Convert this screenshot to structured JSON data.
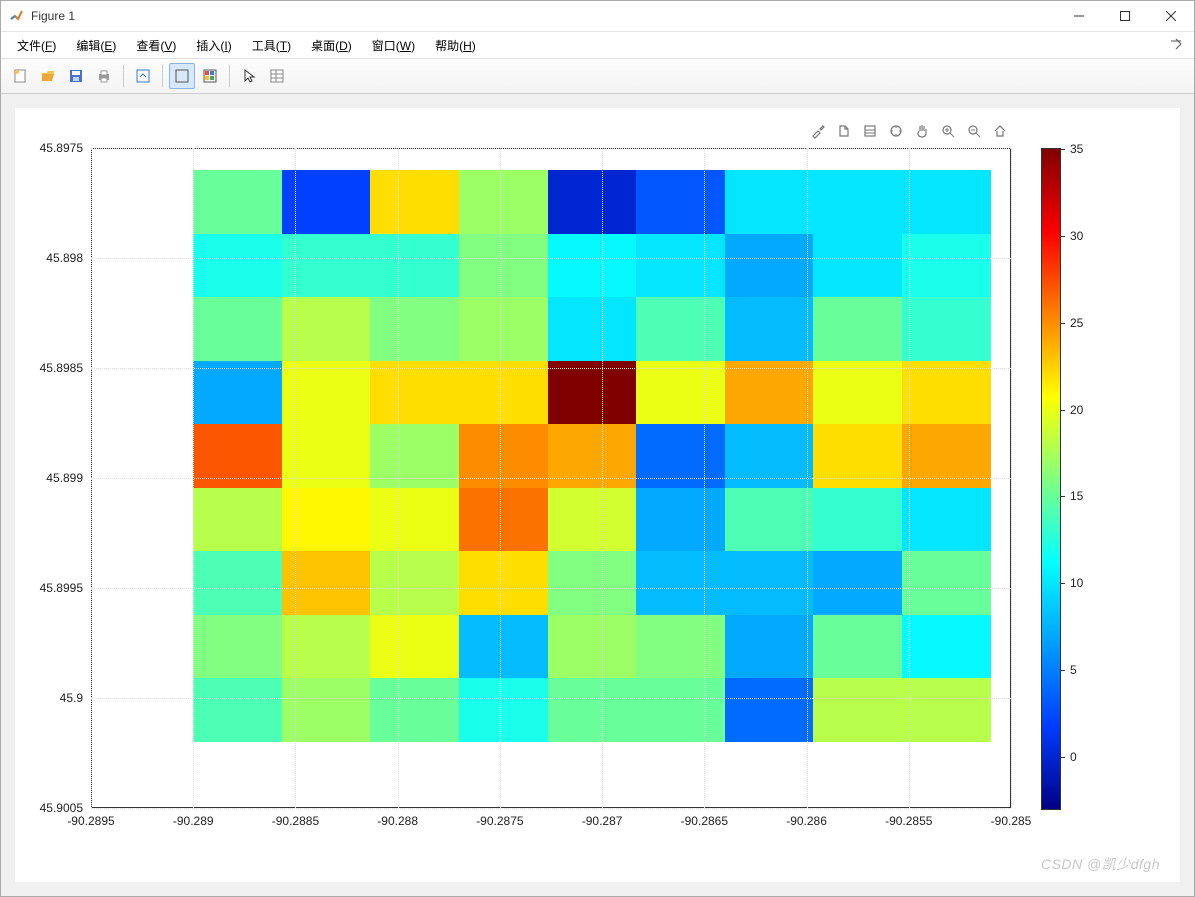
{
  "window": {
    "title": "Figure 1"
  },
  "menus": [
    {
      "label": "文件",
      "accel": "F"
    },
    {
      "label": "编辑",
      "accel": "E"
    },
    {
      "label": "查看",
      "accel": "V"
    },
    {
      "label": "插入",
      "accel": "I"
    },
    {
      "label": "工具",
      "accel": "T"
    },
    {
      "label": "桌面",
      "accel": "D"
    },
    {
      "label": "窗口",
      "accel": "W"
    },
    {
      "label": "帮助",
      "accel": "H"
    }
  ],
  "toolbar": {
    "buttons": [
      "new",
      "open",
      "save",
      "print",
      "sep",
      "link",
      "sep",
      "cursor-select",
      "colorbar",
      "sep",
      "pointer",
      "properties"
    ]
  },
  "figtoolbar": [
    "brush",
    "export",
    "insert-legend",
    "data-tips",
    "pan",
    "zoom-in",
    "zoom-out",
    "home"
  ],
  "watermark": "CSDN @凯少dfgh",
  "chart_data": {
    "type": "heatmap",
    "xlim": [
      -90.2895,
      -90.285
    ],
    "ylim_top_to_bottom": [
      45.8975,
      45.9005
    ],
    "xticks": [
      -90.2895,
      -90.289,
      -90.2885,
      -90.288,
      -90.2875,
      -90.287,
      -90.2865,
      -90.286,
      -90.2855,
      -90.285
    ],
    "yticks": [
      45.8975,
      45.898,
      45.8985,
      45.899,
      45.8995,
      45.9,
      45.9005
    ],
    "colorbar": {
      "min": -3,
      "max": 35,
      "ticks": [
        0,
        5,
        10,
        15,
        20,
        25,
        30,
        35
      ]
    },
    "data_extent": {
      "x0": -90.289,
      "x1": -90.2851,
      "y0": 45.8976,
      "y1": 45.9002,
      "cols": 9,
      "rows": 9
    },
    "values_top_to_bottom": [
      [
        15,
        2,
        22,
        17,
        0,
        3,
        10,
        10,
        10
      ],
      [
        12,
        13,
        13,
        16,
        11,
        10,
        7,
        10,
        12
      ],
      [
        15,
        18,
        16,
        17,
        10,
        14,
        8,
        15,
        13
      ],
      [
        7,
        20,
        22,
        22,
        35,
        20,
        24,
        20,
        22
      ],
      [
        27,
        20,
        17,
        25,
        24,
        4,
        8,
        22,
        24
      ],
      [
        18,
        21,
        20,
        26,
        19,
        7,
        14,
        13,
        10
      ],
      [
        14,
        23,
        18,
        22,
        16,
        8,
        8,
        7,
        15
      ],
      [
        16,
        18,
        20,
        8,
        17,
        16,
        7,
        15,
        11
      ],
      [
        14,
        17,
        15,
        12,
        15,
        15,
        4,
        18,
        18
      ]
    ]
  }
}
